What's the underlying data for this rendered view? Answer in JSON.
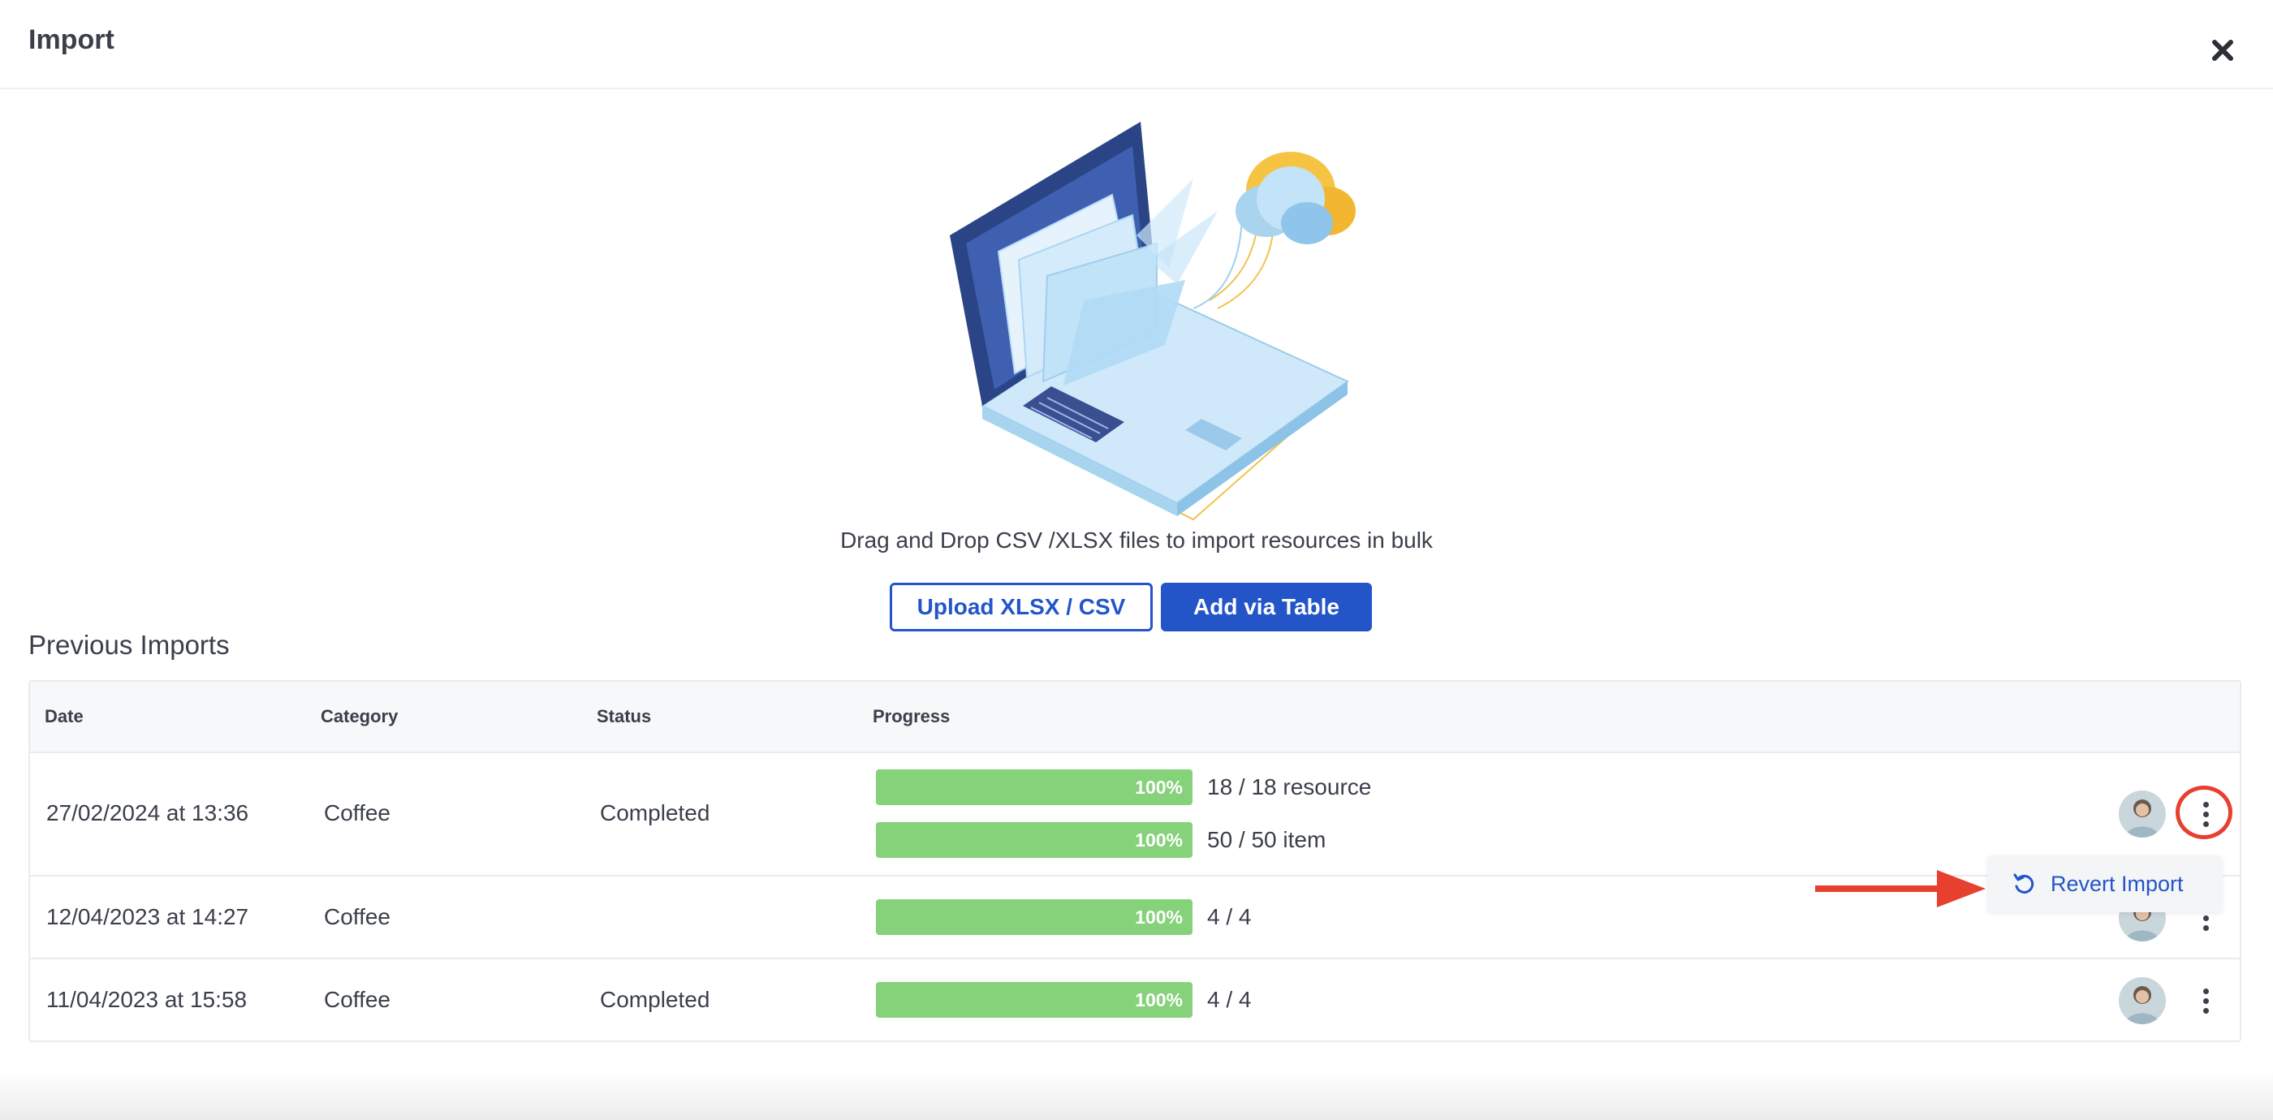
{
  "dialog": {
    "title": "Import"
  },
  "dropzone": {
    "text": "Drag and Drop CSV /XLSX files to import resources in bulk",
    "upload_label": "Upload XLSX / CSV",
    "add_table_label": "Add via Table"
  },
  "previous_imports": {
    "title": "Previous Imports",
    "columns": [
      "Date",
      "Category",
      "Status",
      "Progress"
    ],
    "rows": [
      {
        "date": "27/02/2024 at 13:36",
        "category": "Coffee",
        "status": "Completed",
        "progress": [
          {
            "percent_label": "100%",
            "percent": 100,
            "count": "18 / 18 resource"
          },
          {
            "percent_label": "100%",
            "percent": 100,
            "count": "50 / 50 item"
          }
        ]
      },
      {
        "date": "12/04/2023 at 14:27",
        "category": "Coffee",
        "status": "",
        "progress": [
          {
            "percent_label": "100%",
            "percent": 100,
            "count": "4 / 4"
          }
        ]
      },
      {
        "date": "11/04/2023 at 15:58",
        "category": "Coffee",
        "status": "Completed",
        "progress": [
          {
            "percent_label": "100%",
            "percent": 100,
            "count": "4 / 4"
          }
        ]
      }
    ]
  },
  "context_menu": {
    "revert_label": "Revert Import",
    "icon": "undo-icon"
  },
  "colors": {
    "primary": "#2355c9",
    "progress": "#85d27a",
    "highlight": "#e8402e",
    "text": "#3a3f4a"
  }
}
